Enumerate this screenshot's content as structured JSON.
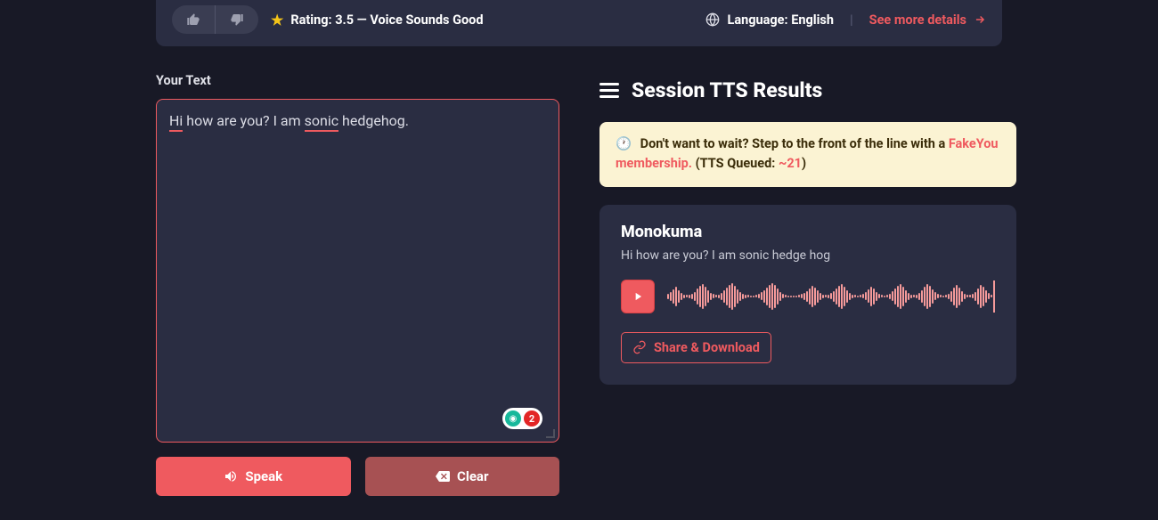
{
  "topbar": {
    "rating_label": "Rating: 3.5 — Voice Sounds Good",
    "language_label": "Language: ",
    "language_value": "English",
    "details_link": "See more details"
  },
  "input": {
    "label": "Your Text",
    "text_parts": [
      "Hi",
      " how are you? I am ",
      "sonic",
      " hedgehog."
    ],
    "badge_count": "2"
  },
  "buttons": {
    "speak": "Speak",
    "clear": "Clear"
  },
  "results": {
    "heading": "Session TTS Results",
    "notice": {
      "prefix": "Don't want to wait? Step to the front of the line with a ",
      "link": "FakeYou membership.",
      "queue_prefix": " (TTS Queued: ",
      "queue_value": "~21",
      "queue_suffix": ")"
    },
    "item": {
      "title": "Monokuma",
      "text": "Hi how are you? I am sonic hedge hog",
      "share_label": "Share & Download"
    }
  }
}
